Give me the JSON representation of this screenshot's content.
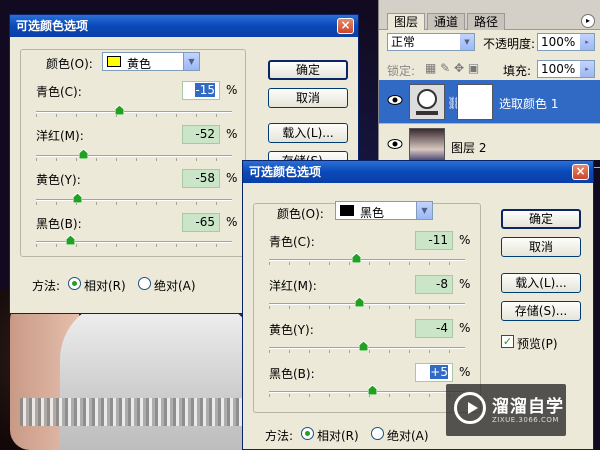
{
  "layers_panel": {
    "tabs": [
      "图层",
      "通道",
      "路径"
    ],
    "blend_mode": "正常",
    "opacity_label": "不透明度:",
    "opacity_value": "100%",
    "lock_label": "锁定:",
    "fill_label": "填充:",
    "fill_value": "100%",
    "layers": [
      {
        "name": "选取颜色 1",
        "selected": true
      },
      {
        "name": "图层 2",
        "selected": false
      }
    ]
  },
  "dialog1": {
    "title": "可选颜色选项",
    "color_label": "颜色(O):",
    "color_value": "黄色",
    "swatch_color": "#ffff00",
    "sliders": [
      {
        "label": "青色(C):",
        "value": "-15"
      },
      {
        "label": "洋红(M):",
        "value": "-52"
      },
      {
        "label": "黄色(Y):",
        "value": "-58"
      },
      {
        "label": "黑色(B):",
        "value": "-65"
      }
    ],
    "slider_positions": [
      -15,
      -52,
      -58,
      -65
    ],
    "percent": "%",
    "method_label": "方法:",
    "method_relative": "相对(R)",
    "method_absolute": "绝对(A)",
    "buttons": {
      "ok": "确定",
      "cancel": "取消",
      "load": "载入(L)...",
      "save": "存储(S)..."
    }
  },
  "dialog2": {
    "title": "可选颜色选项",
    "color_label": "颜色(O):",
    "color_value": "黑色",
    "swatch_color": "#000000",
    "sliders": [
      {
        "label": "青色(C):",
        "value": "-11"
      },
      {
        "label": "洋红(M):",
        "value": "-8"
      },
      {
        "label": "黄色(Y):",
        "value": "-4"
      },
      {
        "label": "黑色(B):",
        "value": "+5"
      }
    ],
    "slider_positions": [
      -11,
      -8,
      -4,
      5
    ],
    "percent": "%",
    "method_label": "方法:",
    "method_relative": "相对(R)",
    "method_absolute": "绝对(A)",
    "buttons": {
      "ok": "确定",
      "cancel": "取消",
      "load": "载入(L)...",
      "save": "存储(S)...",
      "preview": "预览(P)"
    }
  },
  "watermark": {
    "name": "溜溜自学",
    "sub": "ZIXUE.3066.COM"
  }
}
